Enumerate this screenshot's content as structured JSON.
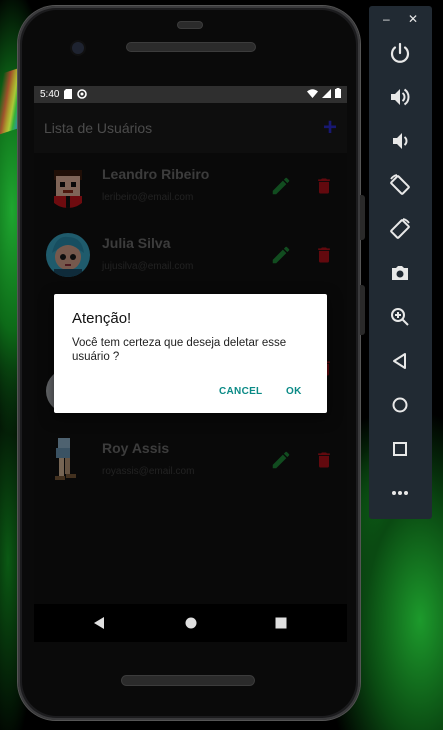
{
  "statusbar": {
    "time": "5:40"
  },
  "appbar": {
    "title": "Lista de Usuários",
    "add_icon": "+"
  },
  "users": [
    {
      "name": "Leandro Ribeiro",
      "email": "leribeiro@email.com"
    },
    {
      "name": "Julia Silva",
      "email": "jujusilva@email.com"
    },
    {
      "name": "Roy Assis",
      "email": "royassis@email.com"
    }
  ],
  "dialog": {
    "title": "Atenção!",
    "message": "Você tem certeza que deseja deletar esse usuário ?",
    "cancel_label": "CANCEL",
    "ok_label": "OK"
  },
  "emulator": {
    "minimize_label": "–",
    "close_label": "✕",
    "tools": [
      "power-icon",
      "volume-up-icon",
      "volume-down-icon",
      "rotate-left-icon",
      "rotate-right-icon",
      "camera-icon",
      "zoom-icon",
      "back-icon",
      "home-icon",
      "overview-icon",
      "more-icon"
    ]
  },
  "colors": {
    "accent_teal": "#0a8a86",
    "edit_green": "#1f8a3a",
    "delete_red": "#b3121a",
    "add_blue": "#2c2ccf"
  }
}
